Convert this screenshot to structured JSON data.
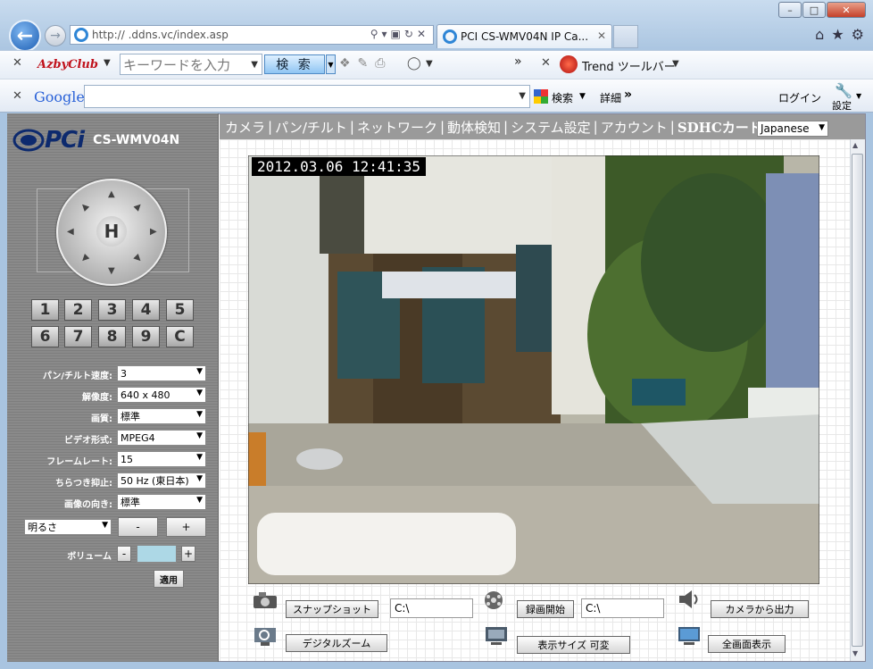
{
  "browser": {
    "address_url": "http://        .ddns.vc/index.asp",
    "tab_title": "PCI CS-WMV04N IP Ca...",
    "win_controls": [
      "–",
      "□",
      "✕"
    ]
  },
  "toolbar1": {
    "azby_label": "AzbyClub",
    "keyword_placeholder": "キーワードを入力",
    "search_button": "検 索",
    "overflow": "»",
    "trend_label": "Trend ツールバー"
  },
  "toolbar2": {
    "google_label": "Google",
    "search_label": "検索",
    "detail_label": "詳細",
    "overflow": "»",
    "login_label": "ログイン",
    "settings_label": "設定"
  },
  "sidebar": {
    "logo_text": "PCi",
    "model": "CS-WMV04N",
    "ptz_center": "H",
    "preset_buttons": [
      "1",
      "2",
      "3",
      "4",
      "5",
      "6",
      "7",
      "8",
      "9",
      "C"
    ],
    "settings": [
      {
        "label": "パン/チルト速度:",
        "value": "3"
      },
      {
        "label": "解像度:",
        "value": "640 x 480"
      },
      {
        "label": "画質:",
        "value": "標準"
      },
      {
        "label": "ビデオ形式:",
        "value": "MPEG4"
      },
      {
        "label": "フレームレート:",
        "value": "15"
      },
      {
        "label": "ちらつき抑止:",
        "value": "50 Hz (東日本)"
      },
      {
        "label": "画像の向き:",
        "value": "標準"
      }
    ],
    "brightness_select": "明るさ",
    "minus": "-",
    "plus": "+",
    "volume_label": "ボリューム",
    "apply": "適用"
  },
  "menu": {
    "items": [
      "カメラ",
      "パン/チルト",
      "ネットワーク",
      "動体検知",
      "システム設定",
      "アカウント",
      "SDHCカード"
    ],
    "separator": "|",
    "language": "Japanese"
  },
  "video": {
    "timestamp": "2012.03.06 12:41:35"
  },
  "controls": {
    "snapshot": "スナップショット",
    "snapshot_path": "C:\\",
    "record_start": "録画開始",
    "record_path": "C:\\",
    "camera_output": "カメラから出力",
    "digital_zoom": "デジタルズーム",
    "display_size": "表示サイズ 可変",
    "fullscreen": "全画面表示"
  }
}
